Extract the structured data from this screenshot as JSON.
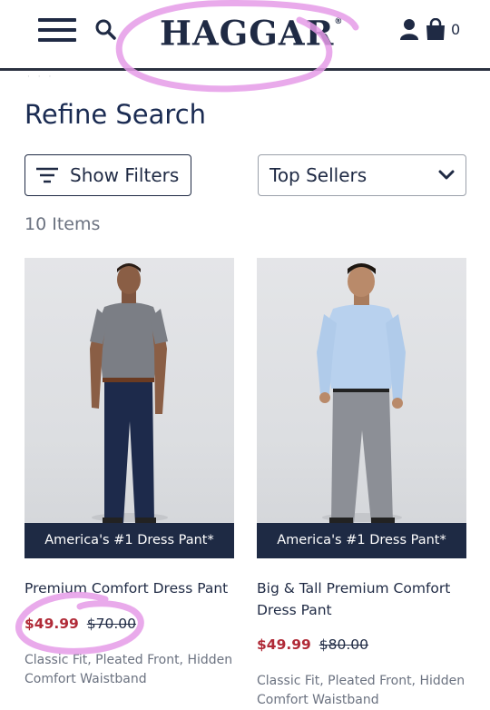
{
  "header": {
    "logo_text": "HAGGAR",
    "logo_mark": "®",
    "cart_count": "0",
    "icons": [
      "menu-icon",
      "search-icon",
      "account-icon",
      "shopping-bag-icon"
    ],
    "underlink_text": "· · ·"
  },
  "page": {
    "title": "Refine Search",
    "filters_label": "Show Filters",
    "sort_selected": "Top Sellers",
    "item_count": "10 Items"
  },
  "colors": {
    "brand_navy": "#1f2a44",
    "sale_red": "#b02a37",
    "annotation_pink": "#e59be8"
  },
  "products": [
    {
      "badge": "America's #1 Dress Pant*",
      "name": "Premium Comfort Dress Pant",
      "sale_price": "$49.99",
      "original_price": "$70.00",
      "description": "Classic Fit, Pleated Front, Hidden Comfort Waistband"
    },
    {
      "badge": "America's #1 Dress Pant*",
      "name": "Big & Tall Premium Comfort Dress Pant",
      "sale_price": "$49.99",
      "original_price": "$80.00",
      "description": "Classic Fit, Pleated Front, Hidden Comfort Waistband"
    }
  ]
}
